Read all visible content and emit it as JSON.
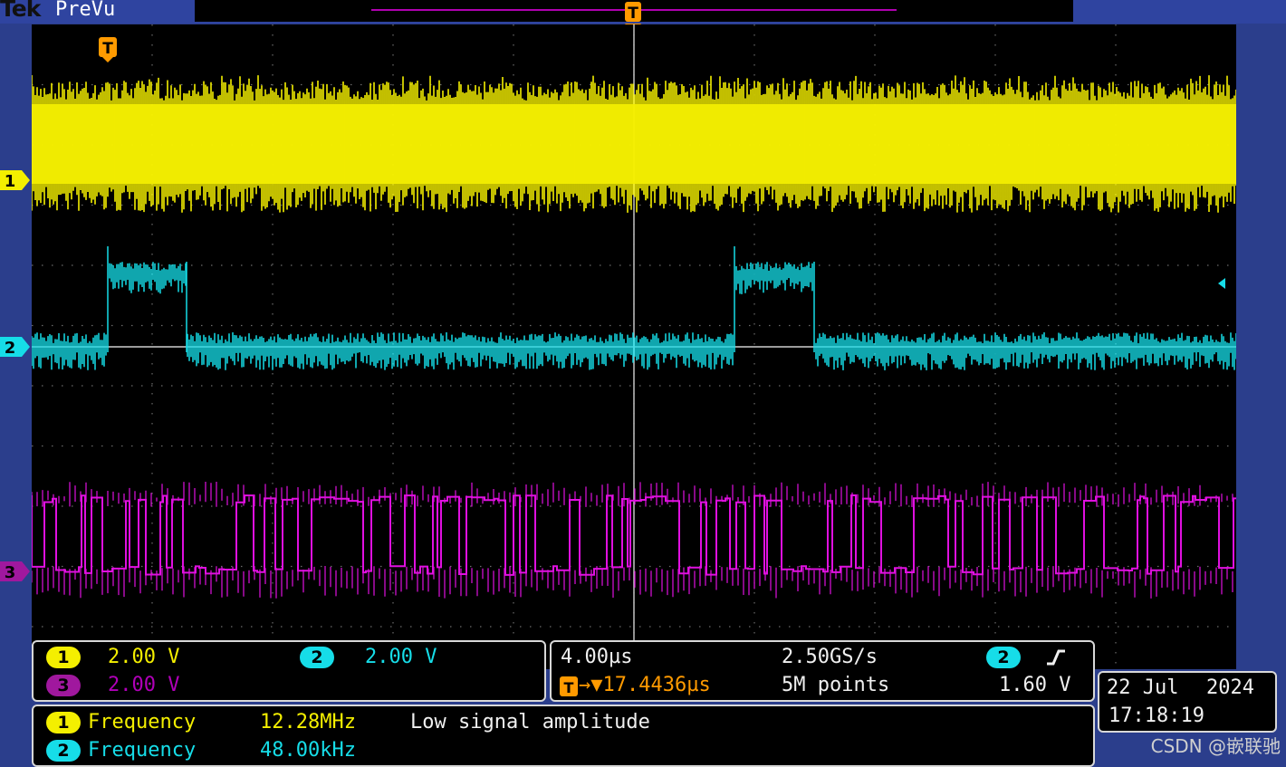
{
  "header": {
    "brand": "Tek",
    "mode": "PreVu"
  },
  "trigger_markers": {
    "top": "T",
    "screen": "T"
  },
  "channels": [
    {
      "id": "1",
      "color": "#f4ef00",
      "scale": "2.00 V"
    },
    {
      "id": "2",
      "color": "#16dde8",
      "scale": "2.00 V"
    },
    {
      "id": "3",
      "color": "#e010e0",
      "scale": "2.00 V"
    }
  ],
  "horizontal": {
    "time_per_div": "4.00µs",
    "sample_rate": "2.50GS/s",
    "trigger_delay": "→▼17.4436µs",
    "record_length": "5M points",
    "trigger_source": "2",
    "trigger_slope_icon": "rising-edge-icon",
    "trigger_level": "1.60 V"
  },
  "datetime": {
    "date_day": "22 Jul",
    "date_year": "2024",
    "time": "17:18:19"
  },
  "measurements": [
    {
      "channel": "1",
      "label": "Frequency",
      "value": "12.28MHz",
      "note": "Low signal amplitude"
    },
    {
      "channel": "2",
      "label": "Frequency",
      "value": "48.00kHz",
      "note": ""
    }
  ],
  "watermark": "CSDN @嵌联驰"
}
